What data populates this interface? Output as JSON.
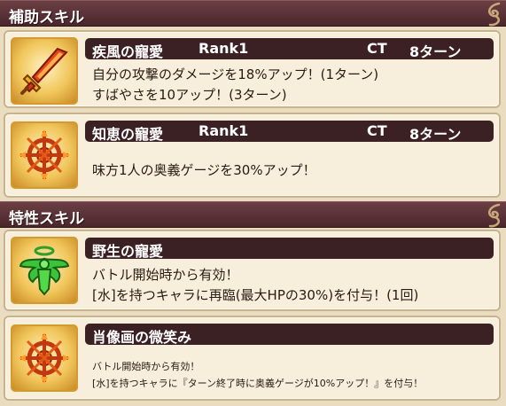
{
  "sections": {
    "support": {
      "title": "補助スキル"
    },
    "trait": {
      "title": "特性スキル"
    }
  },
  "skills": [
    {
      "name": "疾風の寵愛",
      "rank": "Rank1",
      "ct_label": "CT",
      "ct_value": "8ターン",
      "lines": [
        "自分の攻撃のダメージを18%アップ！(1ターン)",
        "すばやさを10アップ！(3ターン)"
      ],
      "icon": "flame-sword-icon"
    },
    {
      "name": "知恵の寵愛",
      "rank": "Rank1",
      "ct_label": "CT",
      "ct_value": "8ターン",
      "lines": [
        "味方1人の奥義ゲージを30%アップ！"
      ],
      "icon": "fire-sigil-icon"
    },
    {
      "name": "野生の寵愛",
      "lines": [
        "バトル開始時から有効！",
        "[水]を持つキャラに再臨(最大HPの30%)を付与！(1回)"
      ],
      "icon": "green-winged-angel-icon"
    },
    {
      "name": "肖像画の微笑み",
      "lines": [
        "バトル開始時から有効！",
        "[水]を持つキャラに『ターン終了時に奥義ゲージが10%アップ！』を付与！"
      ],
      "icon": "fire-sigil-icon"
    }
  ],
  "colors": {
    "header_bg": "#4a272b",
    "card_bg": "#f7efdb",
    "name_bar_bg": "#3b2024",
    "icon_border": "#d39b2f"
  }
}
